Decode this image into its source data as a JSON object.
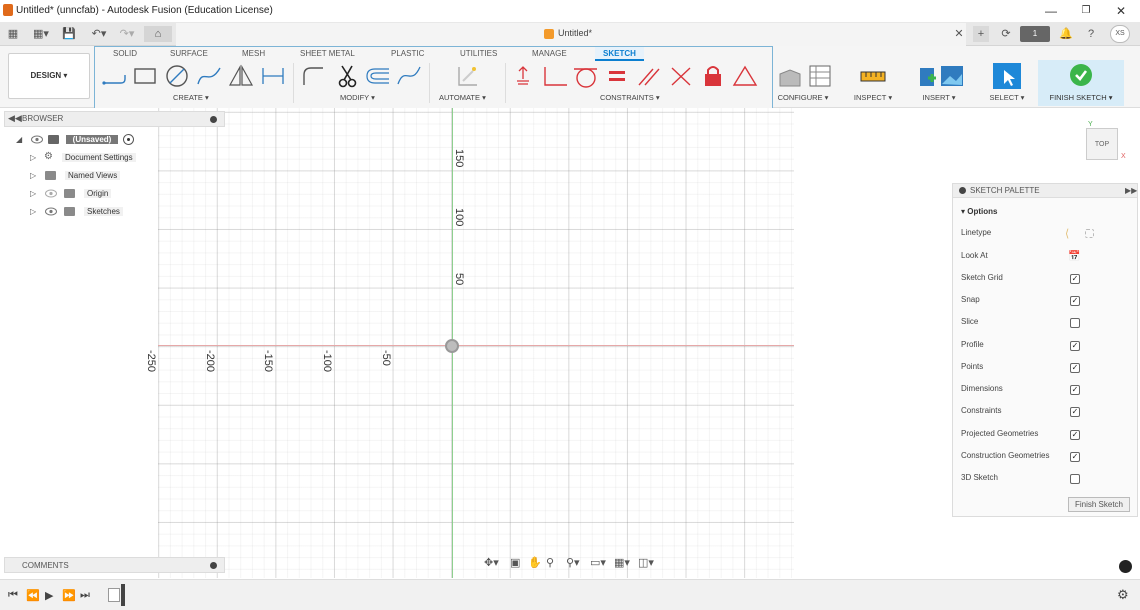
{
  "window": {
    "title": "Untitled* (unncfab) - Autodesk Fusion (Education License)"
  },
  "document_tab": {
    "title": "Untitled*"
  },
  "user": {
    "initials": "XS",
    "jobs_count": "1"
  },
  "workspace": {
    "label": "DESIGN"
  },
  "ribbon_tabs": [
    "SOLID",
    "SURFACE",
    "MESH",
    "SHEET METAL",
    "PLASTIC",
    "UTILITIES",
    "MANAGE",
    "SKETCH"
  ],
  "ribbon_groups": {
    "create": "CREATE",
    "modify": "MODIFY",
    "automate": "AUTOMATE",
    "constraints": "CONSTRAINTS",
    "configure": "CONFIGURE",
    "inspect": "INSPECT",
    "insert": "INSERT",
    "select": "SELECT",
    "finish_sketch": "FINISH SKETCH"
  },
  "browser": {
    "title": "BROWSER",
    "root": "(Unsaved)",
    "items": [
      "Document Settings",
      "Named Views",
      "Origin",
      "Sketches"
    ]
  },
  "comments": {
    "title": "COMMENTS"
  },
  "canvas": {
    "x_ticks": [
      "-250",
      "-200",
      "-150",
      "-100",
      "-50"
    ],
    "y_ticks": [
      "150",
      "100",
      "50"
    ]
  },
  "viewcube": {
    "face": "TOP",
    "x": "X",
    "y": "Y"
  },
  "palette": {
    "title": "SKETCH PALETTE",
    "section": "Options",
    "options": [
      {
        "label": "Linetype",
        "type": "icons"
      },
      {
        "label": "Look At",
        "type": "icon"
      },
      {
        "label": "Sketch Grid",
        "checked": "✓"
      },
      {
        "label": "Snap",
        "checked": "✓"
      },
      {
        "label": "Slice",
        "checked": ""
      },
      {
        "label": "Profile",
        "checked": "✓"
      },
      {
        "label": "Points",
        "checked": "✓"
      },
      {
        "label": "Dimensions",
        "checked": "✓"
      },
      {
        "label": "Constraints",
        "checked": "✓"
      },
      {
        "label": "Projected Geometries",
        "checked": "✓"
      },
      {
        "label": "Construction Geometries",
        "checked": "✓"
      },
      {
        "label": "3D Sketch",
        "checked": ""
      }
    ],
    "finish_button": "Finish Sketch"
  },
  "colors": {
    "accent": "#0c7fd0",
    "finish_green": "#3bb54a",
    "constraint_red": "#d9353b",
    "x_axis": "#e6a8a8",
    "y_axis": "#8fd08f"
  }
}
